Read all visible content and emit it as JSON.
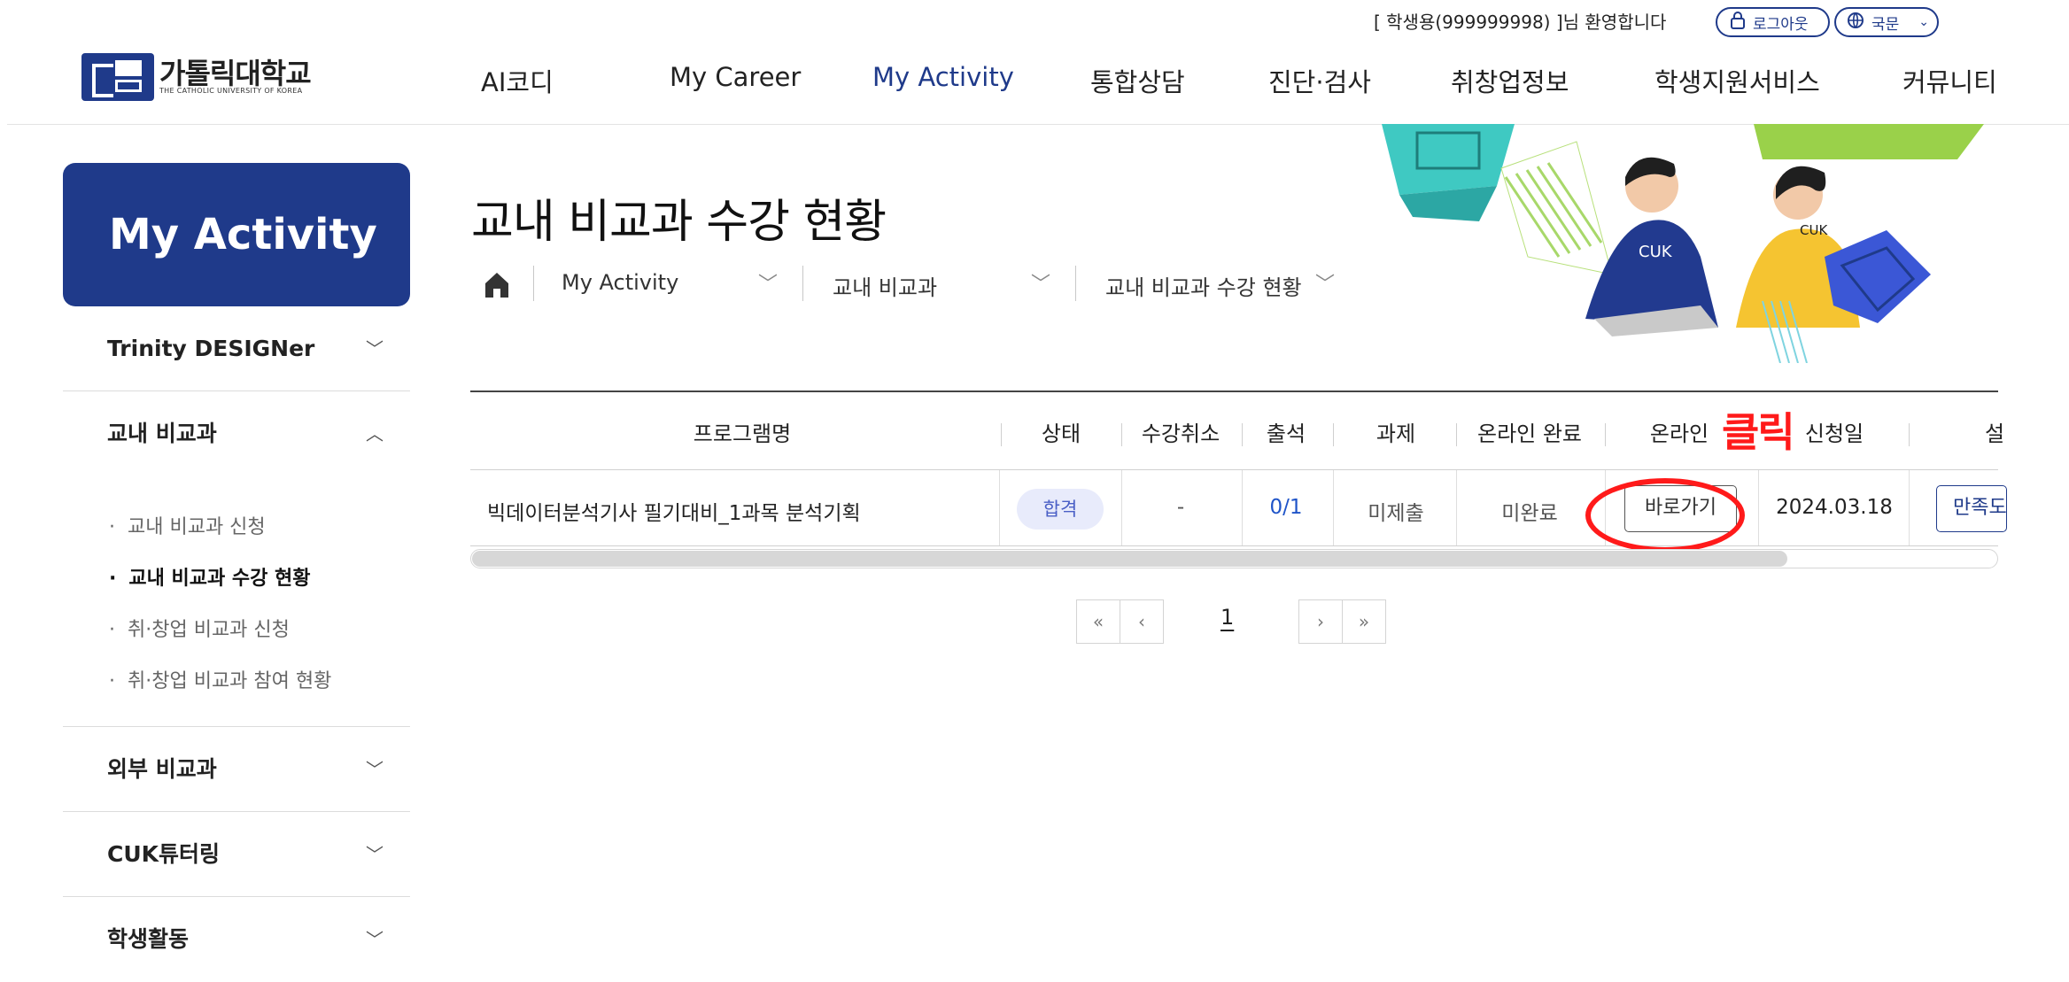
{
  "header": {
    "welcome": "[ 학생용(999999998) ]님 환영합니다",
    "logout_label": "로그아웃",
    "lang_label": "국문",
    "logo_name": "가톨릭대학교",
    "logo_sub": "THE CATHOLIC UNIVERSITY OF KOREA",
    "nav": [
      "AI코디",
      "My Career",
      "My Activity",
      "통합상담",
      "진단·검사",
      "취창업정보",
      "학생지원서비스",
      "커뮤니티"
    ]
  },
  "sidebar": {
    "title": "My Activity",
    "sections": [
      "Trinity DESIGNer",
      "교내 비교과",
      "외부 비교과",
      "CUK튜터링",
      "학생활동"
    ],
    "sub_items": [
      "교내 비교과 신청",
      "교내 비교과 수강 현황",
      "취·창업 비교과 신청",
      "취·창업 비교과 참여 현황"
    ]
  },
  "page": {
    "title": "교내 비교과 수강 현황",
    "breadcrumb": [
      "My Activity",
      "교내 비교과",
      "교내 비교과 수강 현황"
    ]
  },
  "table": {
    "headers": [
      "프로그램명",
      "상태",
      "수강취소",
      "출석",
      "과제",
      "온라인 완료",
      "온라인",
      "신청일",
      "설"
    ],
    "row": {
      "program": "빅데이터분석기사 필기대비_1과목 분석기획",
      "status": "합격",
      "cancel": "-",
      "attendance": "0/1",
      "assignment": "미제출",
      "online_done": "미완료",
      "online_button": "바로가기",
      "date": "2024.03.18",
      "survey_button": "만족도"
    }
  },
  "annotation": {
    "label": "클릭",
    "color": "#ff1a1a"
  },
  "pagination": {
    "first": "«",
    "prev": "‹",
    "current": "1",
    "next": "›",
    "last": "»"
  },
  "colors": {
    "brand": "#1f3a8a",
    "badge_bg": "#e8ebfb",
    "link": "#1f54c8"
  }
}
